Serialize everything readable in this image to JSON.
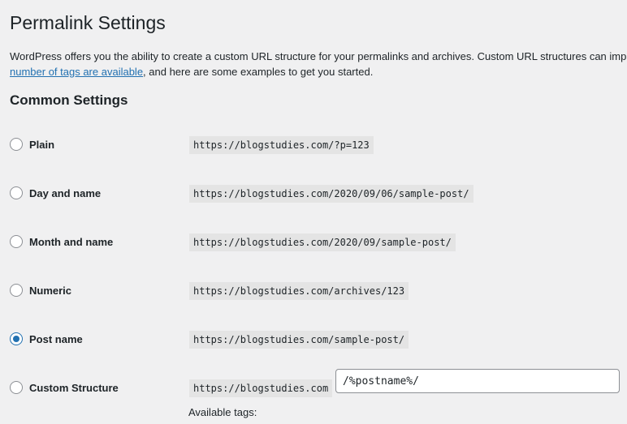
{
  "page": {
    "title": "Permalink Settings",
    "intro_line1": "WordPress offers you the ability to create a custom URL structure for your permalinks and archives. Custom URL structures can impro",
    "intro_link": "number of tags are available",
    "intro_line2_rest": ", and here are some examples to get you started."
  },
  "common_settings": {
    "title": "Common Settings",
    "options": [
      {
        "label": "Plain",
        "example": "https://blogstudies.com/?p=123",
        "checked": false
      },
      {
        "label": "Day and name",
        "example": "https://blogstudies.com/2020/09/06/sample-post/",
        "checked": false
      },
      {
        "label": "Month and name",
        "example": "https://blogstudies.com/2020/09/sample-post/",
        "checked": false
      },
      {
        "label": "Numeric",
        "example": "https://blogstudies.com/archives/123",
        "checked": false
      },
      {
        "label": "Post name",
        "example": "https://blogstudies.com/sample-post/",
        "checked": true
      },
      {
        "label": "Custom Structure",
        "example": "https://blogstudies.com",
        "checked": false
      }
    ],
    "custom_structure_value": "/%postname%/",
    "available_tags_label": "Available tags:"
  },
  "colors": {
    "accent": "#2271b1",
    "background": "#f0f0f1",
    "code_background": "#e4e4e4"
  }
}
